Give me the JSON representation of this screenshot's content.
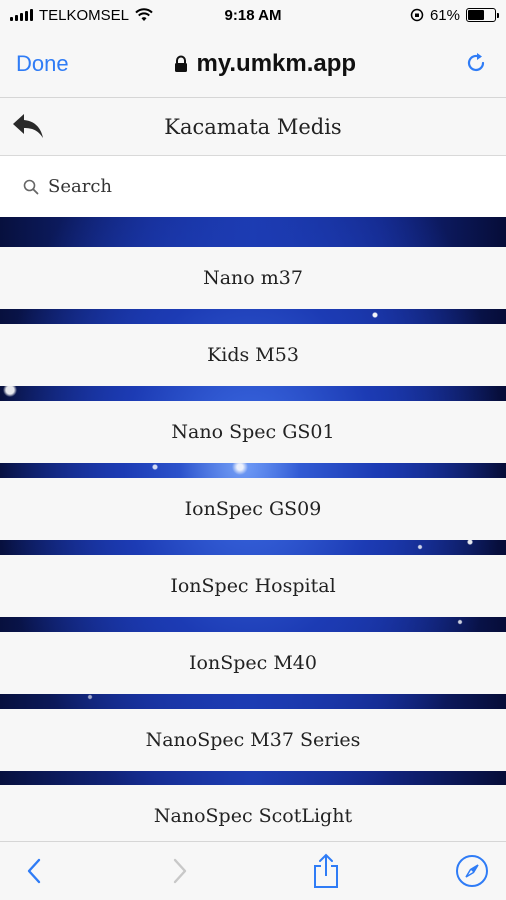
{
  "status_bar": {
    "carrier": "TELKOMSEL",
    "time": "9:18 AM",
    "battery_percent": "61%",
    "battery_level": 0.61
  },
  "browser": {
    "done_label": "Done",
    "url": "my.umkm.app",
    "accent_color": "#2f7cf6"
  },
  "header": {
    "title": "Kacamata Medis"
  },
  "search": {
    "placeholder": "Search"
  },
  "items": [
    {
      "label": "Nano m37"
    },
    {
      "label": "Kids M53"
    },
    {
      "label": "Nano Spec GS01"
    },
    {
      "label": "IonSpec GS09"
    },
    {
      "label": "IonSpec Hospital"
    },
    {
      "label": "IonSpec M40"
    },
    {
      "label": "NanoSpec M37 Series"
    },
    {
      "label": "NanoSpec ScotLight"
    }
  ],
  "toolbar": {
    "icons": [
      "chevron-left-icon",
      "chevron-right-icon",
      "share-icon",
      "compass-icon"
    ]
  }
}
